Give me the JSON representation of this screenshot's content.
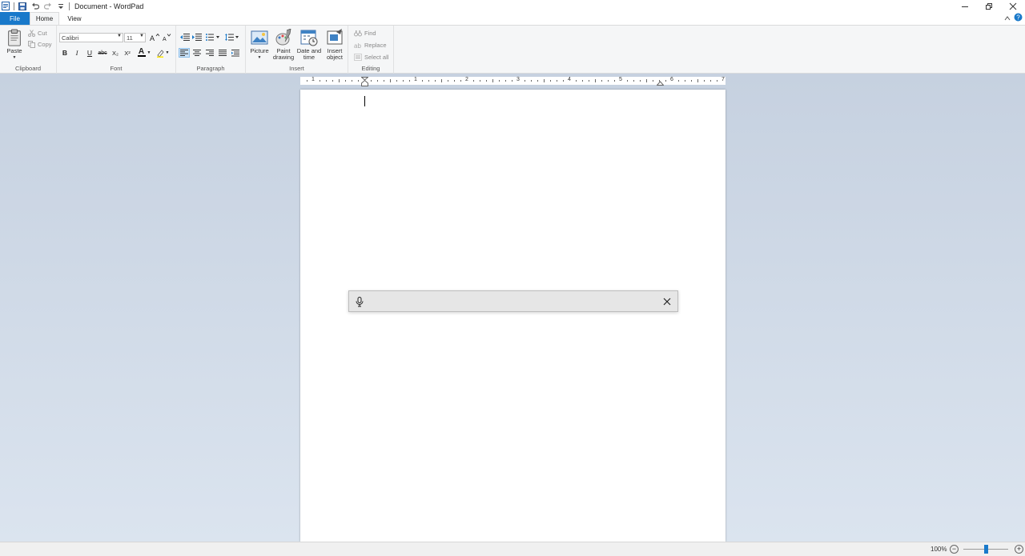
{
  "window": {
    "title": "Document - WordPad"
  },
  "tabs": [
    {
      "label": "File"
    },
    {
      "label": "Home"
    },
    {
      "label": "View"
    }
  ],
  "ribbon": {
    "clipboard": {
      "label": "Clipboard",
      "paste": "Paste",
      "cut": "Cut",
      "copy": "Copy"
    },
    "font": {
      "label": "Font",
      "family": "Calibri",
      "size": "11",
      "bold": "B",
      "italic": "I",
      "underline": "U",
      "strike": "abc",
      "subscript": "X₂",
      "superscript": "X²",
      "color": "A"
    },
    "paragraph": {
      "label": "Paragraph"
    },
    "insert": {
      "label": "Insert",
      "picture": "Picture",
      "paint_line1": "Paint",
      "paint_line2": "drawing",
      "date_line1": "Date and",
      "date_line2": "time",
      "object_line1": "Insert",
      "object_line2": "object"
    },
    "editing": {
      "label": "Editing",
      "find": "Find",
      "replace": "Replace",
      "select_all": "Select all"
    }
  },
  "ruler": {
    "numbers": [
      "1",
      "1",
      "2",
      "3",
      "4",
      "5",
      "6",
      "7"
    ]
  },
  "status": {
    "zoom": "100%"
  },
  "colors": {
    "accent": "#1979ca",
    "ribbon_bg": "#f5f6f7",
    "doc_bg_top": "#c6d1e0",
    "doc_bg_bottom": "#dbe4ef"
  }
}
